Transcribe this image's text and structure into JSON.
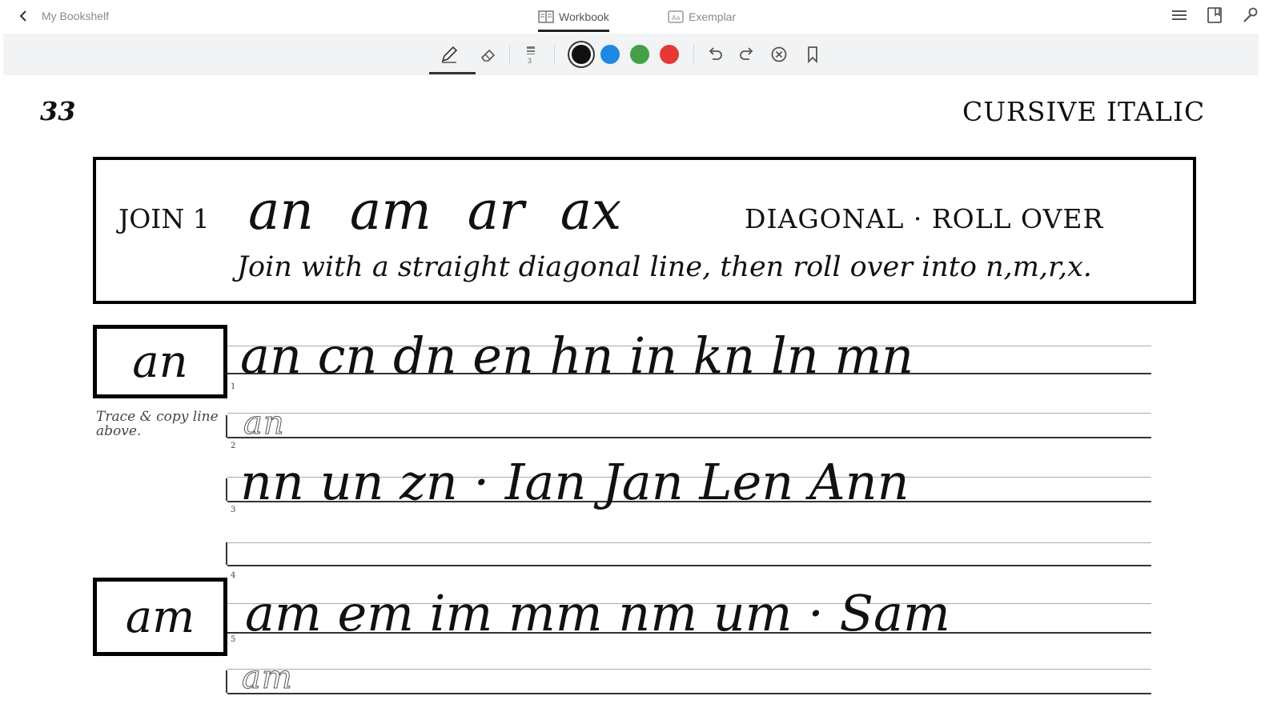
{
  "topbar": {
    "back_label": "My Bookshelf",
    "tabs": [
      {
        "label": "Workbook",
        "active": true
      },
      {
        "label": "Exemplar",
        "active": false
      }
    ]
  },
  "toolbar": {
    "tools": [
      "pen",
      "eraser",
      "stroke-size",
      "undo",
      "redo",
      "clear",
      "bookmark"
    ],
    "stroke_size_value": "3",
    "colors": [
      {
        "name": "black",
        "hex": "#111111",
        "selected": true
      },
      {
        "name": "blue",
        "hex": "#1e88e5",
        "selected": false
      },
      {
        "name": "green",
        "hex": "#43a047",
        "selected": false
      },
      {
        "name": "red",
        "hex": "#e53935",
        "selected": false
      }
    ]
  },
  "page": {
    "number": "33",
    "heading": "CURSIVE ITALIC",
    "lesson": {
      "join_label": "JOIN 1",
      "pairs": [
        "an",
        "am",
        "ar",
        "ax"
      ],
      "type_label": "DIAGONAL · ROLL OVER",
      "instruction": "Join with a straight diagonal line, then roll over into n,m,r,x."
    },
    "exercises": [
      {
        "label": "an",
        "line1": "an cn dn en hn in kn ln mn",
        "line2_trace": "an",
        "line3": "nn un zn · Ian Jan Len Ann"
      },
      {
        "label": "am",
        "line1": "am em im mm nm um · Sam",
        "line2_trace": "am"
      }
    ],
    "trace_note": "Trace & copy line above.",
    "line_numbers": [
      "1",
      "2",
      "3",
      "4",
      "5"
    ]
  }
}
